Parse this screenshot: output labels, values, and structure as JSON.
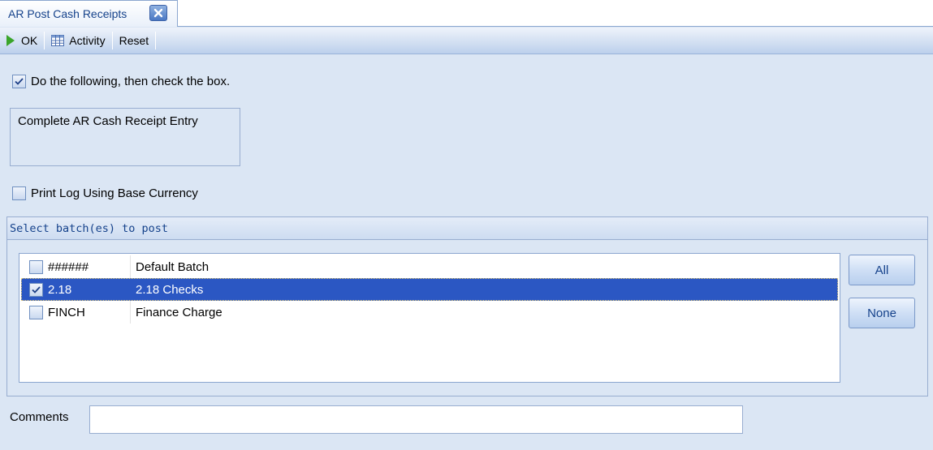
{
  "tab": {
    "title": "AR Post Cash Receipts",
    "close_icon": "close-icon"
  },
  "toolbar": {
    "ok_label": "OK",
    "activity_label": "Activity",
    "reset_label": "Reset"
  },
  "instruction": {
    "checkbox_label": "Do the following, then check the box.",
    "checked": true,
    "box_text": "Complete AR Cash Receipt Entry"
  },
  "print_log": {
    "label": "Print Log Using Base Currency",
    "checked": false
  },
  "batch_group": {
    "header": "Select batch(es) to post",
    "rows": [
      {
        "code": "######",
        "description": "Default Batch",
        "checked": false,
        "selected": false
      },
      {
        "code": "2.18",
        "description": "2.18 Checks",
        "checked": true,
        "selected": true
      },
      {
        "code": "FINCH",
        "description": "Finance Charge",
        "checked": false,
        "selected": false
      }
    ],
    "all_label": "All",
    "none_label": "None"
  },
  "comments": {
    "label": "Comments",
    "value": ""
  },
  "colors": {
    "selection": "#2b57c3",
    "accent": "#15428b",
    "background": "#dbe6f4"
  }
}
